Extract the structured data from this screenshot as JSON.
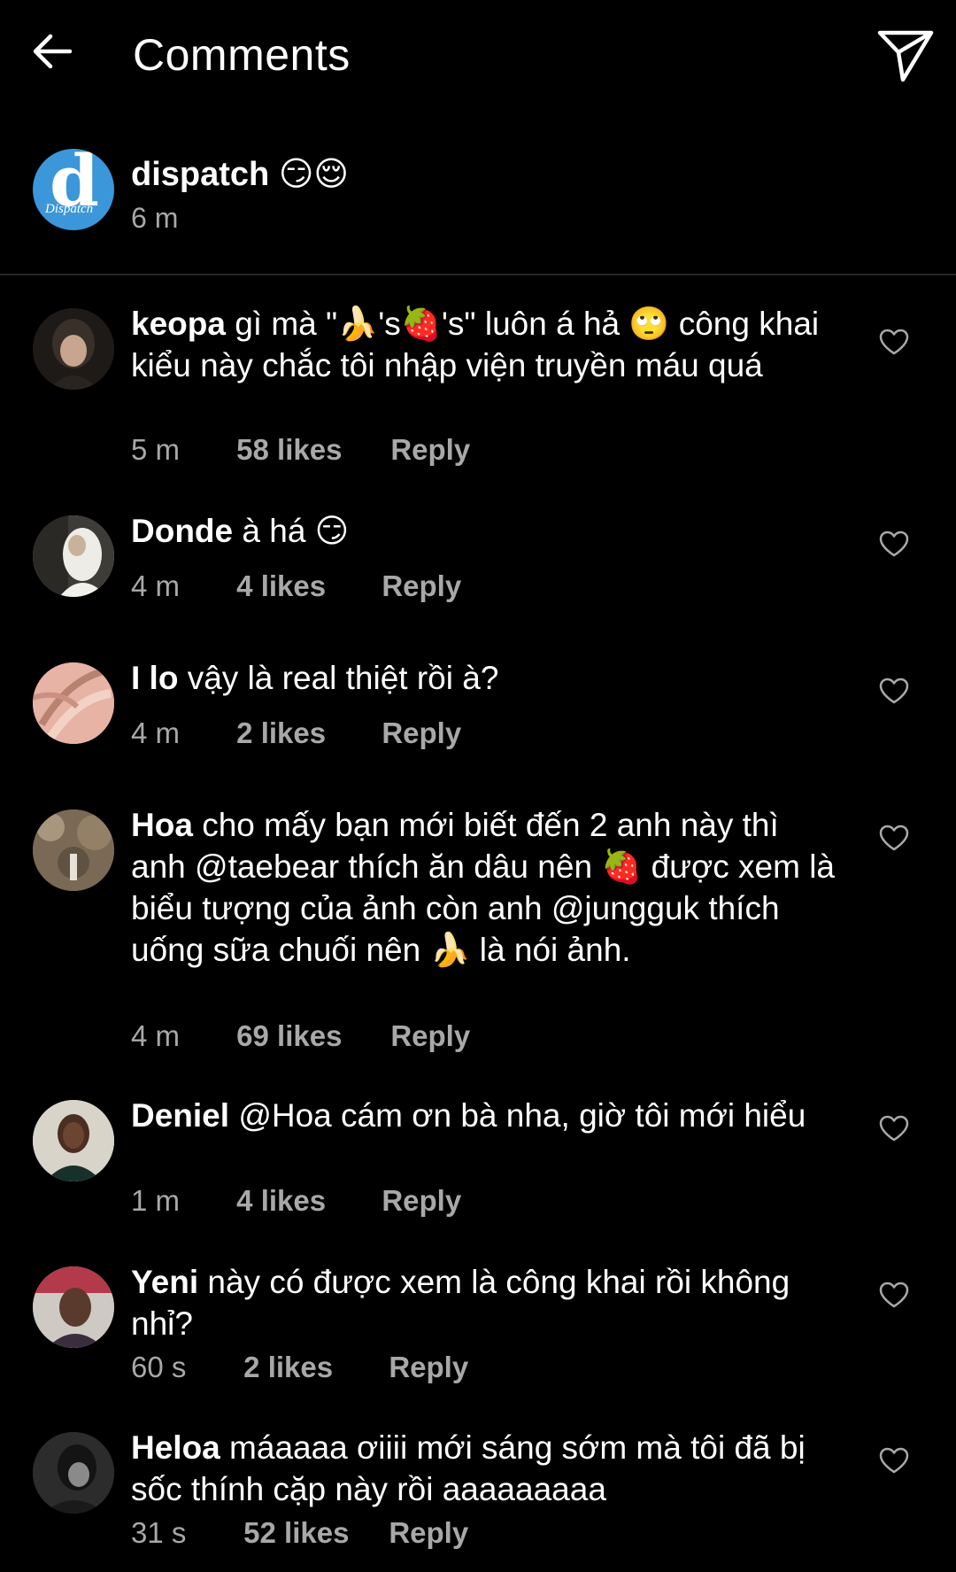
{
  "header": {
    "title": "Comments",
    "back_icon": "arrow-left-icon",
    "share_icon": "paper-plane-icon"
  },
  "caption": {
    "username": "dispatch",
    "emoji": "😏😌",
    "time": "6 m",
    "avatar_letter": "d",
    "avatar_sub": "Dispatch",
    "avatar_color": "#3b97d9"
  },
  "comments": [
    {
      "username": "keopa",
      "text": "gì mà \"🍌's🍓's\" luôn á hả 🙄 công khai kiểu này chắc tôi nhập viện truyền máu quá",
      "time": "5 m",
      "likes": "58 likes",
      "reply": "Reply",
      "avatar_color": "#2b2622"
    },
    {
      "username": "Donde",
      "text": "à há 😏",
      "time": "4 m",
      "likes": "4 likes",
      "reply": "Reply",
      "avatar_color": "#d8d6d2"
    },
    {
      "username": "I lo",
      "text": "vậy là real thiệt rồi à?",
      "time": "4 m",
      "likes": "2 likes",
      "reply": "Reply",
      "avatar_color": "#e0a596"
    },
    {
      "username": "Hoa",
      "text": "cho mấy bạn mới biết đến 2 anh này thì anh @taebear thích ăn dâu nên 🍓 được xem là biểu tượng của ảnh còn anh @jungguk thích uống sữa chuối nên 🍌 là nói ảnh.",
      "time": "4 m",
      "likes": "69 likes",
      "reply": "Reply",
      "avatar_color": "#8c7a62"
    },
    {
      "username": "Deniel",
      "text": "@Hoa cám ơn bà nha, giờ tôi mới hiểu",
      "time": "1 m",
      "likes": "4 likes",
      "reply": "Reply",
      "avatar_color": "#c9c6bd"
    },
    {
      "username": "Yeni",
      "text": "này có được xem là công khai rồi không nhỉ?",
      "time": "60 s",
      "likes": "2 likes",
      "reply": "Reply",
      "avatar_color": "#7d6a5c"
    },
    {
      "username": "Heloa",
      "text": "máaaaa ơiiii mới sáng sớm mà tôi đã bị sốc thính cặp này rồi aaaaaaaaa",
      "time": "31 s",
      "likes": "52 likes",
      "reply": "Reply",
      "avatar_color": "#3a3a3a"
    }
  ],
  "icons": {
    "like": "heart-outline-icon"
  },
  "colors": {
    "background": "#000000",
    "text": "#ffffff",
    "secondary": "#a8a8a8",
    "divider": "#262626"
  }
}
